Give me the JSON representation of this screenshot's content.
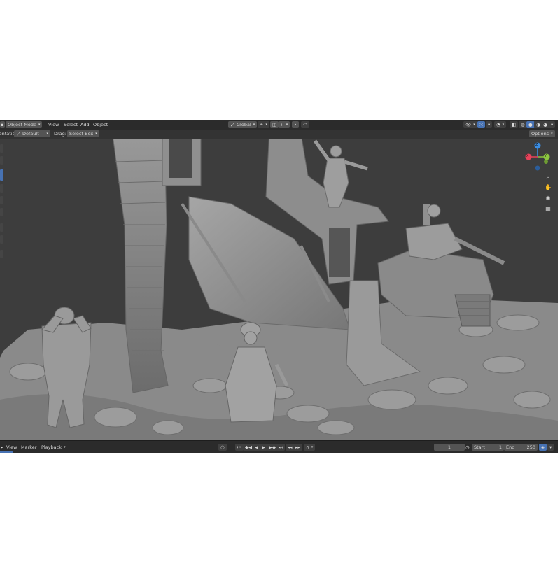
{
  "header": {
    "mode": "Object Mode",
    "menus": [
      "View",
      "Select",
      "Add",
      "Object"
    ],
    "transform_orientation": "Global"
  },
  "tool_settings": {
    "orientation_label": "Orientation:",
    "orientation_value": "Default",
    "drag_label": "Drag:",
    "drag_value": "Select Box",
    "options": "Options"
  },
  "gizmo": {
    "x": "X",
    "y": "Y",
    "z": "Z"
  },
  "timeline": {
    "menus": [
      "View",
      "Marker",
      "Playback"
    ],
    "current_frame": "1",
    "start_label": "Start",
    "start_value": "1",
    "end_label": "End",
    "end_value": "250"
  },
  "colors": {
    "accent": "#4772b3",
    "header_bg": "#2b2b2b",
    "viewport_bg": "#3d3d3d",
    "axis_x": "#e8425a",
    "axis_y": "#8cc63f",
    "axis_z": "#3a8ee6"
  }
}
